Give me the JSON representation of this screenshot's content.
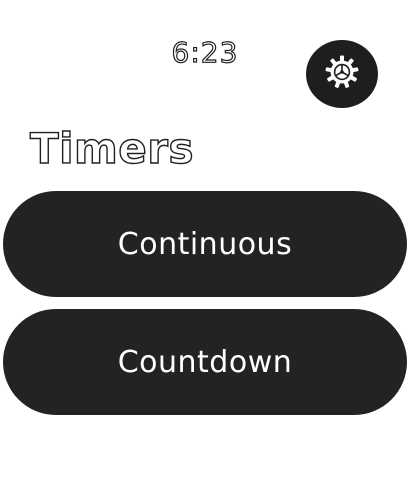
{
  "status": {
    "time": "6:23"
  },
  "header": {
    "title": "Timers",
    "settings_icon": "gear-icon"
  },
  "buttons": [
    {
      "label": "Continuous"
    },
    {
      "label": "Countdown"
    }
  ],
  "colors": {
    "background": "#ffffff",
    "button": "#232325",
    "button_text": "#ffffff",
    "settings_circle": "#1e1e20"
  }
}
